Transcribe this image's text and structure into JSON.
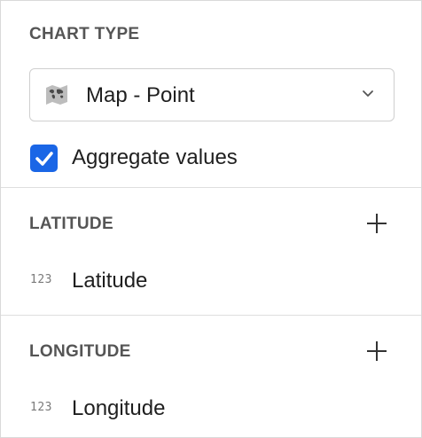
{
  "chart_type": {
    "section_title": "CHART TYPE",
    "selected_label": "Map - Point",
    "selected_icon": "map-icon"
  },
  "aggregate": {
    "label": "Aggregate values",
    "checked": true,
    "check_color": "#1a66e6"
  },
  "latitude": {
    "section_title": "LATITUDE",
    "add_icon": "plus-icon",
    "field": {
      "type_badge": "123",
      "label": "Latitude"
    }
  },
  "longitude": {
    "section_title": "LONGITUDE",
    "add_icon": "plus-icon",
    "field": {
      "type_badge": "123",
      "label": "Longitude"
    }
  }
}
